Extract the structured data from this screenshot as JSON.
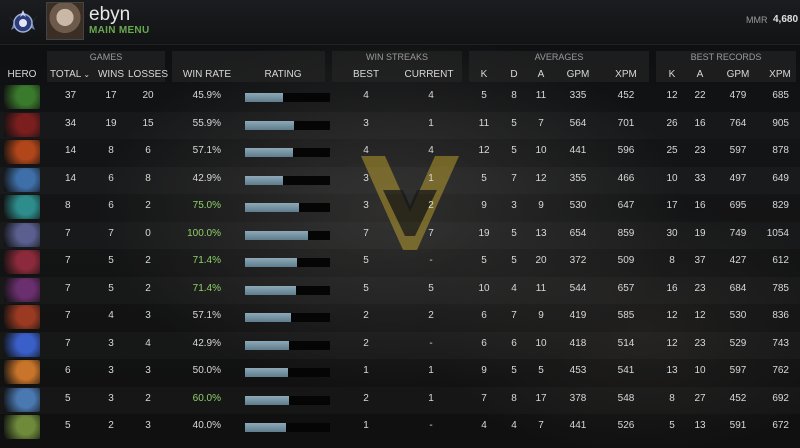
{
  "topbar": {
    "username": "ebyn",
    "main_menu": "MAIN MENU",
    "mmr_label": "MMR",
    "mmr_value": "4,680"
  },
  "groups": {
    "games": "GAMES",
    "win_streaks": "WIN STREAKS",
    "averages": "AVERAGES",
    "best_records": "BEST RECORDS"
  },
  "headers": {
    "hero": "HERO",
    "total": "TOTAL",
    "wins": "WINS",
    "losses": "LOSSES",
    "win_rate": "WIN RATE",
    "rating": "RATING",
    "best": "BEST",
    "current": "CURRENT",
    "k": "K",
    "d": "D",
    "a": "A",
    "gpm": "GPM",
    "xpm": "XPM",
    "rk": "K",
    "ra": "A",
    "rgpm": "GPM",
    "rxpm": "XPM"
  },
  "rows": [
    {
      "total": "37",
      "wins": "17",
      "losses": "20",
      "wr": "45.9%",
      "rating": 0.45,
      "best": "4",
      "current": "4",
      "k": "5",
      "d": "8",
      "a": "11",
      "gpm": "335",
      "xpm": "452",
      "rk": "12",
      "ra": "22",
      "rgpm": "479",
      "rxpm": "685",
      "hero_color": "#3a7a2c",
      "green": false
    },
    {
      "total": "34",
      "wins": "19",
      "losses": "15",
      "wr": "55.9%",
      "rating": 0.58,
      "best": "3",
      "current": "1",
      "k": "11",
      "d": "5",
      "a": "7",
      "gpm": "564",
      "xpm": "701",
      "rk": "26",
      "ra": "16",
      "rgpm": "764",
      "rxpm": "905",
      "hero_color": "#7a1e1e",
      "green": false
    },
    {
      "total": "14",
      "wins": "8",
      "losses": "6",
      "wr": "57.1%",
      "rating": 0.56,
      "best": "4",
      "current": "4",
      "k": "12",
      "d": "5",
      "a": "10",
      "gpm": "441",
      "xpm": "596",
      "rk": "25",
      "ra": "23",
      "rgpm": "597",
      "rxpm": "878",
      "hero_color": "#b0461a",
      "green": false
    },
    {
      "total": "14",
      "wins": "6",
      "losses": "8",
      "wr": "42.9%",
      "rating": 0.45,
      "best": "3",
      "current": "1",
      "k": "5",
      "d": "7",
      "a": "12",
      "gpm": "355",
      "xpm": "466",
      "rk": "10",
      "ra": "33",
      "rgpm": "497",
      "rxpm": "649",
      "hero_color": "#3f6fa8",
      "green": false
    },
    {
      "total": "8",
      "wins": "6",
      "losses": "2",
      "wr": "75.0%",
      "rating": 0.63,
      "best": "3",
      "current": "2",
      "k": "9",
      "d": "3",
      "a": "9",
      "gpm": "530",
      "xpm": "647",
      "rk": "17",
      "ra": "16",
      "rgpm": "695",
      "rxpm": "829",
      "hero_color": "#2e8c8c",
      "green": true
    },
    {
      "total": "7",
      "wins": "7",
      "losses": "0",
      "wr": "100.0%",
      "rating": 0.74,
      "best": "7",
      "current": "7",
      "k": "19",
      "d": "5",
      "a": "13",
      "gpm": "654",
      "xpm": "859",
      "rk": "30",
      "ra": "19",
      "rgpm": "749",
      "rxpm": "1054",
      "hero_color": "#5a5f8f",
      "green": true
    },
    {
      "total": "7",
      "wins": "5",
      "losses": "2",
      "wr": "71.4%",
      "rating": 0.61,
      "best": "5",
      "current": "-",
      "k": "5",
      "d": "5",
      "a": "20",
      "gpm": "372",
      "xpm": "509",
      "rk": "8",
      "ra": "37",
      "rgpm": "427",
      "rxpm": "612",
      "hero_color": "#8a2a3a",
      "green": true
    },
    {
      "total": "7",
      "wins": "5",
      "losses": "2",
      "wr": "71.4%",
      "rating": 0.6,
      "best": "5",
      "current": "5",
      "k": "10",
      "d": "4",
      "a": "11",
      "gpm": "544",
      "xpm": "657",
      "rk": "16",
      "ra": "23",
      "rgpm": "684",
      "rxpm": "785",
      "hero_color": "#6a2f6e",
      "green": true
    },
    {
      "total": "7",
      "wins": "4",
      "losses": "3",
      "wr": "57.1%",
      "rating": 0.54,
      "best": "2",
      "current": "2",
      "k": "6",
      "d": "7",
      "a": "9",
      "gpm": "419",
      "xpm": "585",
      "rk": "12",
      "ra": "12",
      "rgpm": "530",
      "rxpm": "836",
      "hero_color": "#9a3a22",
      "green": false
    },
    {
      "total": "7",
      "wins": "3",
      "losses": "4",
      "wr": "42.9%",
      "rating": 0.52,
      "best": "2",
      "current": "-",
      "k": "6",
      "d": "6",
      "a": "10",
      "gpm": "418",
      "xpm": "514",
      "rk": "12",
      "ra": "23",
      "rgpm": "529",
      "rxpm": "743",
      "hero_color": "#3a5fc8",
      "green": false
    },
    {
      "total": "6",
      "wins": "3",
      "losses": "3",
      "wr": "50.0%",
      "rating": 0.5,
      "best": "1",
      "current": "1",
      "k": "9",
      "d": "5",
      "a": "5",
      "gpm": "453",
      "xpm": "541",
      "rk": "13",
      "ra": "10",
      "rgpm": "597",
      "rxpm": "762",
      "hero_color": "#c8742a",
      "green": false
    },
    {
      "total": "5",
      "wins": "3",
      "losses": "2",
      "wr": "60.0%",
      "rating": 0.52,
      "best": "2",
      "current": "1",
      "k": "7",
      "d": "8",
      "a": "17",
      "gpm": "378",
      "xpm": "548",
      "rk": "8",
      "ra": "27",
      "rgpm": "452",
      "rxpm": "692",
      "hero_color": "#4a78b0",
      "green": true
    },
    {
      "total": "5",
      "wins": "2",
      "losses": "3",
      "wr": "40.0%",
      "rating": 0.48,
      "best": "1",
      "current": "-",
      "k": "4",
      "d": "4",
      "a": "7",
      "gpm": "441",
      "xpm": "526",
      "rk": "5",
      "ra": "13",
      "rgpm": "591",
      "rxpm": "672",
      "hero_color": "#6e8a3a",
      "green": false
    }
  ]
}
